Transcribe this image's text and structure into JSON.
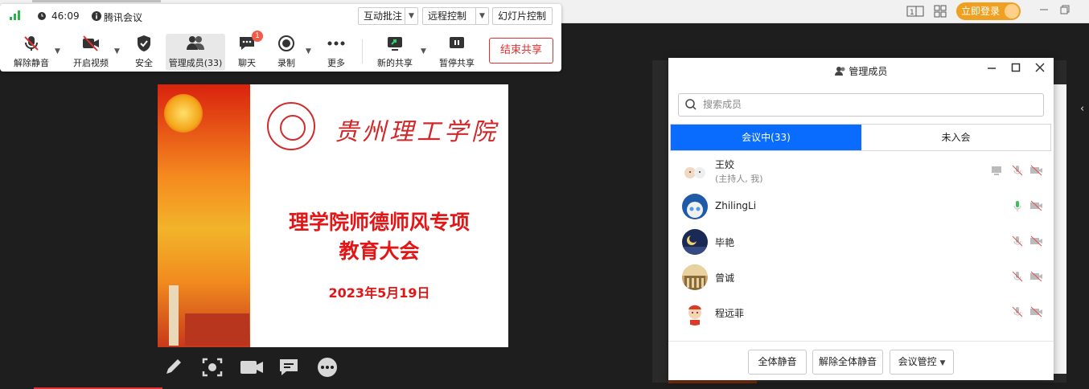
{
  "topbar": {
    "login_label": "立即登录"
  },
  "meeting": {
    "timer": "46:09",
    "app_name": "腾讯会议",
    "top_buttons": {
      "annotate": "互动批注",
      "remote": "远程控制",
      "slideshow": "幻灯片控制"
    },
    "tools": {
      "unmute": "解除静音",
      "video": "开启视频",
      "security": "安全",
      "members": "管理成员(33)",
      "chat": "聊天",
      "chat_badge": "1",
      "record": "录制",
      "more": "更多",
      "new_share": "新的共享",
      "pause_share": "暂停共享",
      "end_share": "结束共享"
    }
  },
  "slide": {
    "university": "贵州理工学院",
    "title_line1": "理学院师德师风专项",
    "title_line2": "教育大会",
    "date": "2023年5月19日"
  },
  "panel": {
    "title": "管理成员",
    "search_placeholder": "搜索成员",
    "tab_in_meeting": "会议中(33)",
    "tab_not_joined": "未入会",
    "members": [
      {
        "name": "王姣",
        "sub": "(主持人, 我)"
      },
      {
        "name": "ZhilingLi"
      },
      {
        "name": "毕艳"
      },
      {
        "name": "曾诚"
      },
      {
        "name": "程远菲"
      }
    ],
    "footer": {
      "mute_all": "全体静音",
      "unmute_all": "解除全体静音",
      "meeting_control": "会议管控"
    }
  },
  "colors": {
    "accent_blue": "#0a6cff",
    "end_red": "#e03030",
    "slide_red": "#e21616",
    "login_orange": "#f0a020"
  }
}
